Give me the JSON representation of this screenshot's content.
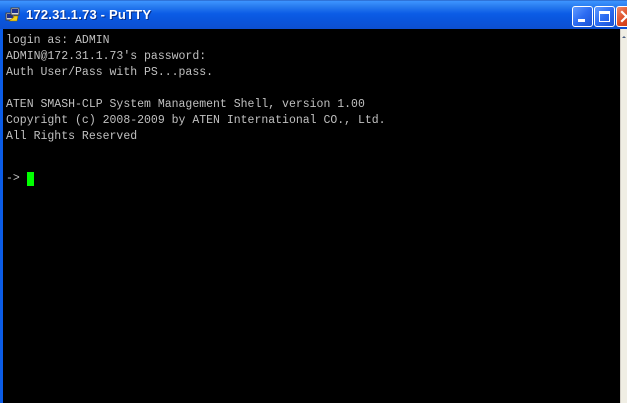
{
  "window": {
    "title": "172.31.1.73 - PuTTY",
    "app_icon": "putty-icon",
    "buttons": {
      "minimize": "minimize-icon",
      "maximize": "maximize-icon",
      "close": "close-icon"
    }
  },
  "terminal": {
    "lines": [
      "login as: ADMIN",
      "ADMIN@172.31.1.73's password:",
      "Auth User/Pass with PS...pass.",
      "",
      "ATEN SMASH-CLP System Management Shell, version 1.00",
      "Copyright (c) 2008-2009 by ATEN International CO., Ltd.",
      "All Rights Reserved"
    ],
    "prompt": "->",
    "cursor_color": "#00ff00",
    "background": "#000000",
    "foreground": "#c0c0c0"
  },
  "colors": {
    "titlebar": "#0b5ce6",
    "close_button": "#dd4a22"
  }
}
